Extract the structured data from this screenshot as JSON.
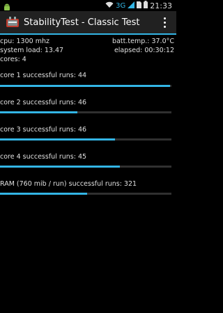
{
  "status_bar": {
    "network": "3G",
    "time": "21:33",
    "icons": [
      "android-icon",
      "wifi-icon",
      "signal-icon",
      "sim-icon",
      "battery-icon"
    ]
  },
  "action_bar": {
    "title": "StabilityTest - Classic Test",
    "icon": "app-icon",
    "menu_icon": "overflow-menu-icon"
  },
  "info": {
    "cpu": "cpu: 1300 mhz",
    "batt_temp": "batt.temp.: 37.0°C",
    "system_load": "system load: 13.47",
    "elapsed": "elapsed: 00:30:12",
    "cores": "cores: 4"
  },
  "rows": [
    {
      "label": "core 1 successful runs: 44",
      "progress": 0.99
    },
    {
      "label": "core 2 successful runs: 46",
      "progress": 0.45
    },
    {
      "label": "core 3 successful runs: 46",
      "progress": 0.67
    },
    {
      "label": "core 4 successful runs: 45",
      "progress": 0.7
    },
    {
      "label": "RAM (760 mib / run) successful runs: 321",
      "progress": 0.51
    }
  ],
  "colors": {
    "accent": "#33b5e5",
    "background": "#000000",
    "action_bar": "#212121",
    "track": "#303030"
  }
}
